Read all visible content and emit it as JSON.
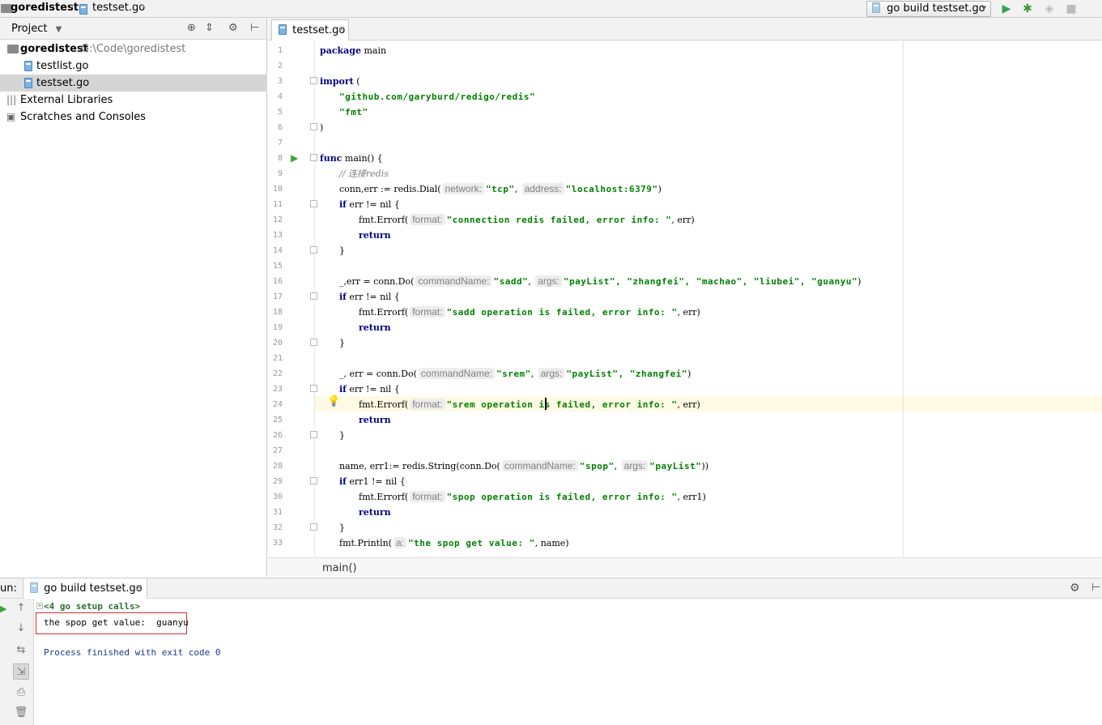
{
  "navbar": {
    "project_crumb": "goredistest",
    "file_crumb": "testset.go",
    "run_config": "go build testset.go"
  },
  "project_panel": {
    "title": "Project",
    "root": {
      "name": "goredistest",
      "path": "G:\\Code\\goredistest"
    },
    "files": [
      "testlist.go",
      "testset.go"
    ],
    "external_libraries": "External Libraries",
    "scratches": "Scratches and Consoles"
  },
  "editor": {
    "tab": "testset.go",
    "breadcrumb": "main()",
    "line_numbers": [
      "1",
      "2",
      "3",
      "4",
      "5",
      "6",
      "7",
      "8",
      "9",
      "10",
      "11",
      "12",
      "13",
      "14",
      "15",
      "16",
      "17",
      "18",
      "19",
      "20",
      "21",
      "22",
      "23",
      "24",
      "25",
      "26",
      "27",
      "28",
      "29",
      "30",
      "31",
      "32",
      "33"
    ],
    "code": {
      "l1_kw": "package",
      "l1_rest": " main",
      "l3_kw": "import",
      "l3_rest": " (",
      "l4": "\"github.com/garyburd/redigo/redis\"",
      "l5": "\"fmt\"",
      "l6": ")",
      "l8_kw": "func",
      "l8_rest": " main() {",
      "l9": "// 连接redis",
      "l10_a": "conn,err := redis.Dial(",
      "l10_h1": "network:",
      "l10_s1": "\"tcp\"",
      "l10_b": ", ",
      "l10_h2": "address:",
      "l10_s2": "\"localhost:6379\"",
      "l10_c": ")",
      "l11_kw": "if",
      "l11_rest": " err != nil {",
      "l12_a": "fmt.Errorf(",
      "l12_h": "format:",
      "l12_s": "\"connection redis failed, error info: \"",
      "l12_c": ", err)",
      "l13_kw": "return",
      "l14": "}",
      "l16_a": "_,err = conn.Do(",
      "l16_h1": "commandName:",
      "l16_s1": "\"sadd\"",
      "l16_b": ", ",
      "l16_h2": "args:",
      "l16_s2": "\"payList\", \"zhangfei\", \"machao\", \"liubei\", \"guanyu\"",
      "l16_c": ")",
      "l17_kw": "if",
      "l17_rest": " err != nil {",
      "l18_a": "fmt.Errorf(",
      "l18_h": "format:",
      "l18_s": "\"sadd operation is failed, error info: \"",
      "l18_c": ", err)",
      "l19_kw": "return",
      "l20": "}",
      "l22_a": "_, err = conn.Do(",
      "l22_h1": "commandName:",
      "l22_s1": "\"srem\"",
      "l22_b": ", ",
      "l22_h2": "args:",
      "l22_s2": "\"payList\", \"zhangfei\"",
      "l22_c": ")",
      "l23_kw": "if",
      "l23_rest": " err != nil {",
      "l24_a": "fmt.Errorf(",
      "l24_h": "format:",
      "l24_s": "\"srem operation is failed, error info: \"",
      "l24_c": ", err)",
      "l25_kw": "return",
      "l26": "}",
      "l28_a": "name, err1:= redis.String(conn.Do(",
      "l28_h1": "commandName:",
      "l28_s1": "\"spop\"",
      "l28_b": ", ",
      "l28_h2": "args:",
      "l28_s2": "\"payList\"",
      "l28_c": "))",
      "l29_kw": "if",
      "l29_rest": " err1 != nil {",
      "l30_a": "fmt.Errorf(",
      "l30_h": "format:",
      "l30_s": "\"spop operation is failed, error info: \"",
      "l30_c": ", err1)",
      "l31_kw": "return",
      "l32": "}",
      "l33_a": "fmt.Println(",
      "l33_h": "a:",
      "l33_s": "\"the spop get value: \"",
      "l33_c": ", name)"
    }
  },
  "run_panel": {
    "label": "un:",
    "tab": "go build testset.go",
    "console": {
      "setup_calls": "<4 go setup calls>",
      "output": "the spop get value:  guanyu",
      "exit": "Process finished with exit code 0"
    }
  },
  "colors": {
    "keyword": "#000080",
    "string": "#008000",
    "comment": "#808080",
    "highlight_box": "#d32f2f"
  }
}
